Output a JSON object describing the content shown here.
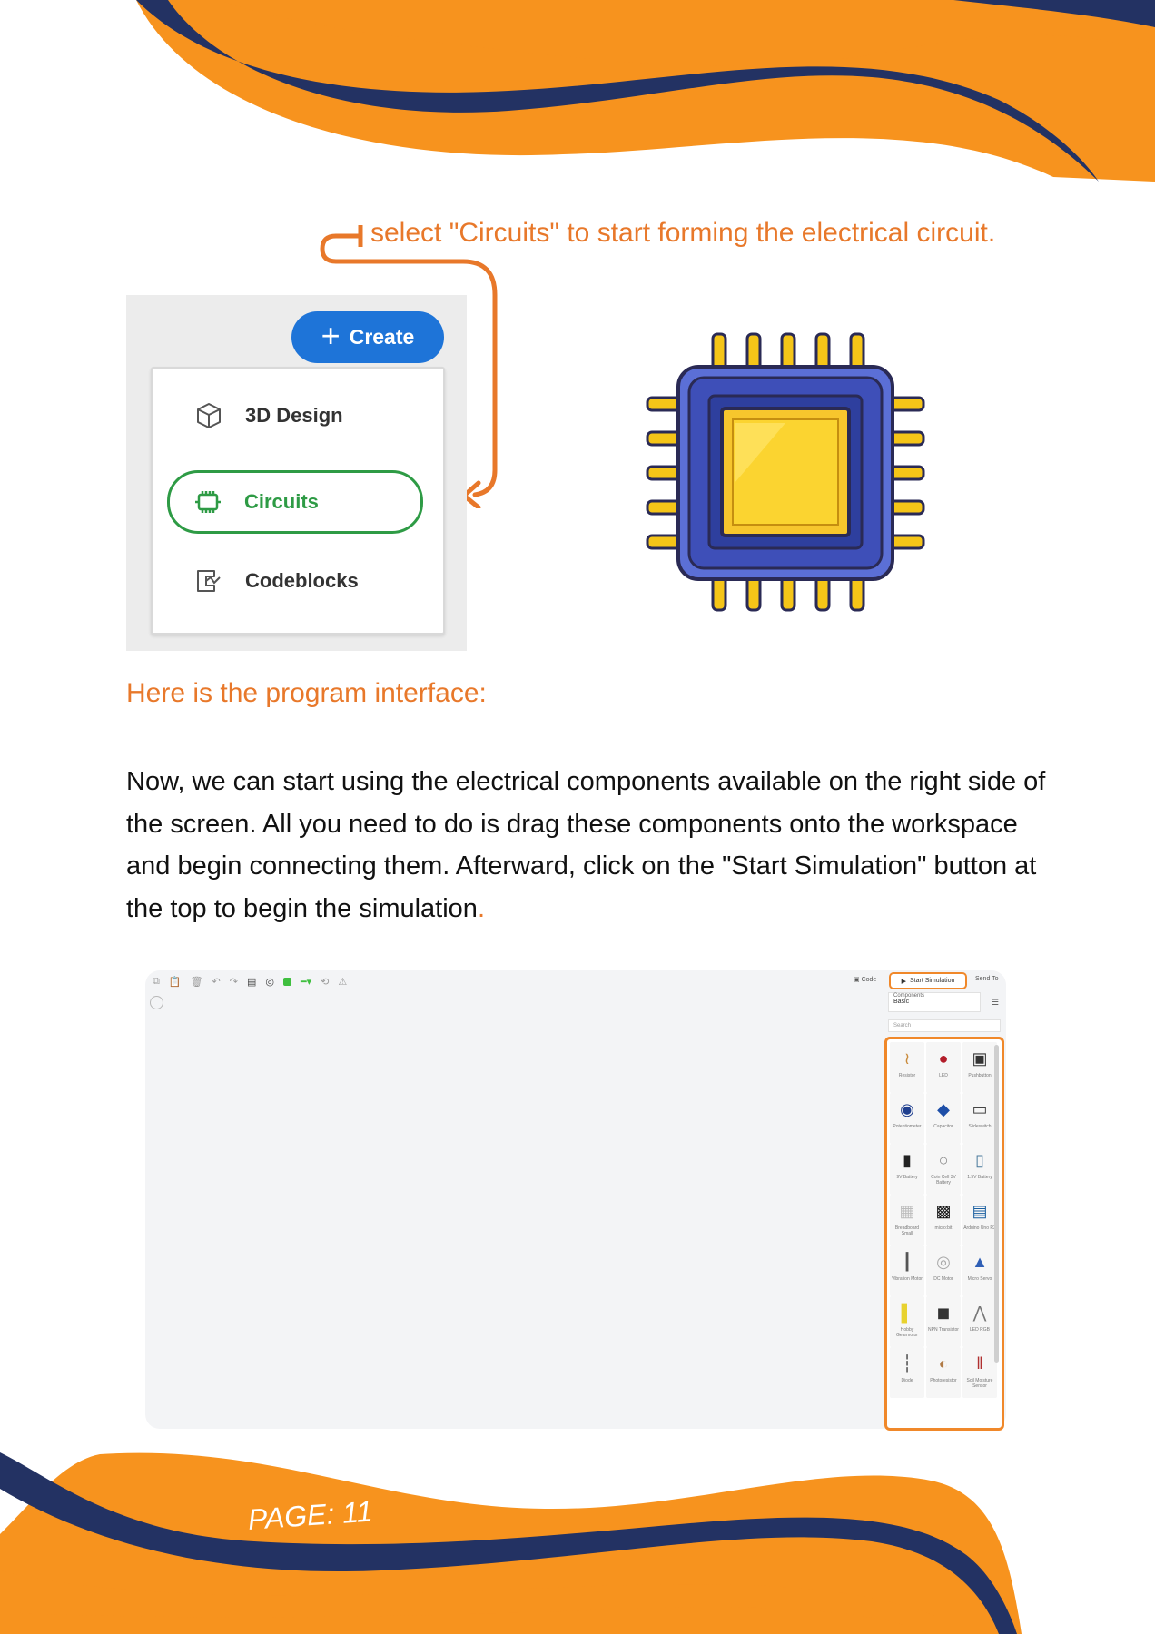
{
  "callout_text": "select \"Circuits\" to start forming the electrical circuit.",
  "create_menu": {
    "create_label": "Create",
    "items": [
      {
        "label": "3D Design",
        "icon": "cube-icon"
      },
      {
        "label": "Circuits",
        "icon": "chip-icon",
        "selected": true
      },
      {
        "label": "Codeblocks",
        "icon": "codeblocks-icon"
      }
    ]
  },
  "heading": "Here is the program interface:",
  "paragraph": "Now, we can start using the electrical components available on the right side of the screen. All you need to do is drag these components onto the workspace and begin connecting them. Afterward, click on the \"Start Simulation\" button at the top to begin the simulation",
  "paragraph_end": ".",
  "simulator": {
    "code_label": "Code",
    "start_label": "Start Simulation",
    "send_label": "Send To",
    "components_label": "Components",
    "components_value": "Basic",
    "search_placeholder": "Search",
    "components": [
      {
        "name": "Resistor"
      },
      {
        "name": "LED"
      },
      {
        "name": "Pushbutton"
      },
      {
        "name": "Potentiometer"
      },
      {
        "name": "Capacitor"
      },
      {
        "name": "Slideswitch"
      },
      {
        "name": "9V Battery"
      },
      {
        "name": "Coin Cell 3V Battery"
      },
      {
        "name": "1.5V Battery"
      },
      {
        "name": "Breadboard Small"
      },
      {
        "name": "micro:bit"
      },
      {
        "name": "Arduino Uno R3"
      },
      {
        "name": "Vibration Motor"
      },
      {
        "name": "DC Motor"
      },
      {
        "name": "Micro Servo"
      },
      {
        "name": "Hobby Gearmotor"
      },
      {
        "name": "NPN Transistor"
      },
      {
        "name": "LED RGB"
      },
      {
        "name": "Diode"
      },
      {
        "name": "Photoresistor"
      },
      {
        "name": "Soil Moisture Sensor"
      }
    ]
  },
  "page_label": "PAGE: 11",
  "colors": {
    "orange": "#f7931e",
    "navy": "#233263",
    "accent_text": "#e8782a",
    "blue_button": "#1e74d8",
    "green_select": "#2e9b45"
  }
}
